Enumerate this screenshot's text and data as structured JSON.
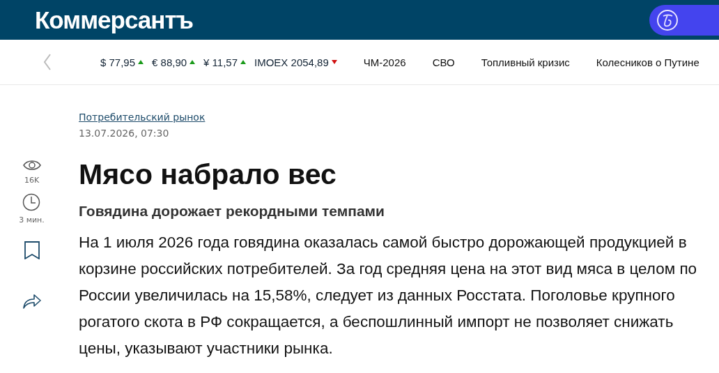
{
  "header": {
    "logo": "Коммерсантъ"
  },
  "ticker": {
    "quotes": [
      {
        "label": "$ 77,95",
        "rising": true
      },
      {
        "label": "€ 88,90",
        "rising": true
      },
      {
        "label": "¥ 11,57",
        "rising": true
      },
      {
        "label": "IMOEX 2054,89",
        "rising": false
      }
    ],
    "topics": [
      "ЧМ-2026",
      "СВО",
      "Топливный кризис",
      "Колесников о Путине"
    ]
  },
  "article": {
    "rubric": "Потребительский рынок",
    "date": "13.07.2026, 07:30",
    "views": "16K",
    "read_time": "3 мин.",
    "title": "Мясо набрало вес",
    "subtitle": "Говядина дорожает рекордными темпами",
    "lead": "На 1 июля 2026 года говядина оказалась самой быстро дорожающей продукцией в корзине российских потребителей. За год средняя цена на этот вид мяса в целом по России увеличилась на 15,58%, следует из данных Росстата. Поголовье крупного рогатого скота в РФ сокращается, а беспошлинный импорт не позволяет снижать цены, указывают участники рынка."
  }
}
